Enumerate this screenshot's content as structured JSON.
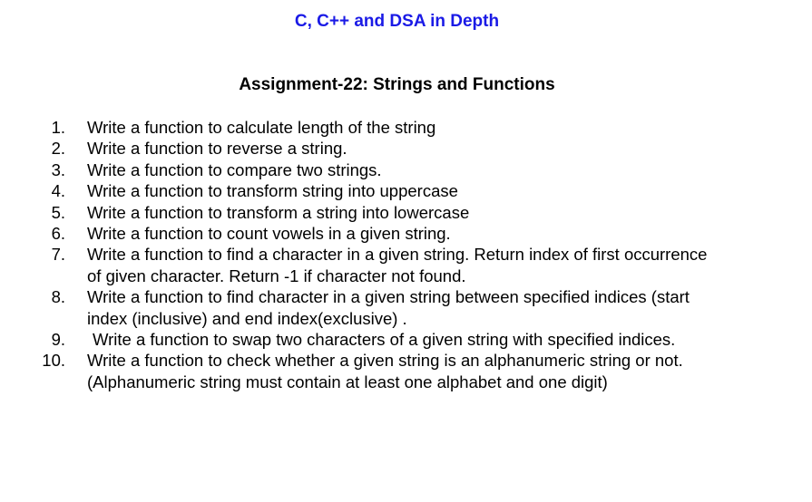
{
  "document": {
    "course_title": "C, C++ and DSA in Depth",
    "assignment_title": "Assignment-22: Strings and Functions",
    "tasks": [
      {
        "number": "1.",
        "lines": [
          "Write a function to calculate length of the string"
        ]
      },
      {
        "number": "2.",
        "lines": [
          "Write a function to reverse a string."
        ]
      },
      {
        "number": "3.",
        "lines": [
          "Write a function to compare two strings."
        ]
      },
      {
        "number": "4.",
        "lines": [
          "Write a function to transform string into uppercase"
        ]
      },
      {
        "number": "5.",
        "lines": [
          "Write a function to transform a string into lowercase"
        ]
      },
      {
        "number": "6.",
        "lines": [
          "Write a function to count vowels in a given string."
        ]
      },
      {
        "number": "7.",
        "lines": [
          "Write a function to find a character in a given string. Return index of first occurrence",
          "of given character. Return -1 if character not found."
        ]
      },
      {
        "number": "8.",
        "lines": [
          "Write a function to find character in a given string between specified indices (start",
          "index (inclusive) and end index(exclusive) ."
        ]
      },
      {
        "number": "9.",
        "lines": [
          "Write a function to swap two characters of a given string with specified indices."
        ]
      },
      {
        "number": "10.",
        "lines": [
          "Write a function to check whether a given string is an alphanumeric string or not.",
          "(Alphanumeric string must contain at least one alphabet and one digit)"
        ]
      }
    ]
  },
  "colors": {
    "course_title": "#1a1ae6",
    "body_text": "#000000",
    "background": "#ffffff"
  }
}
